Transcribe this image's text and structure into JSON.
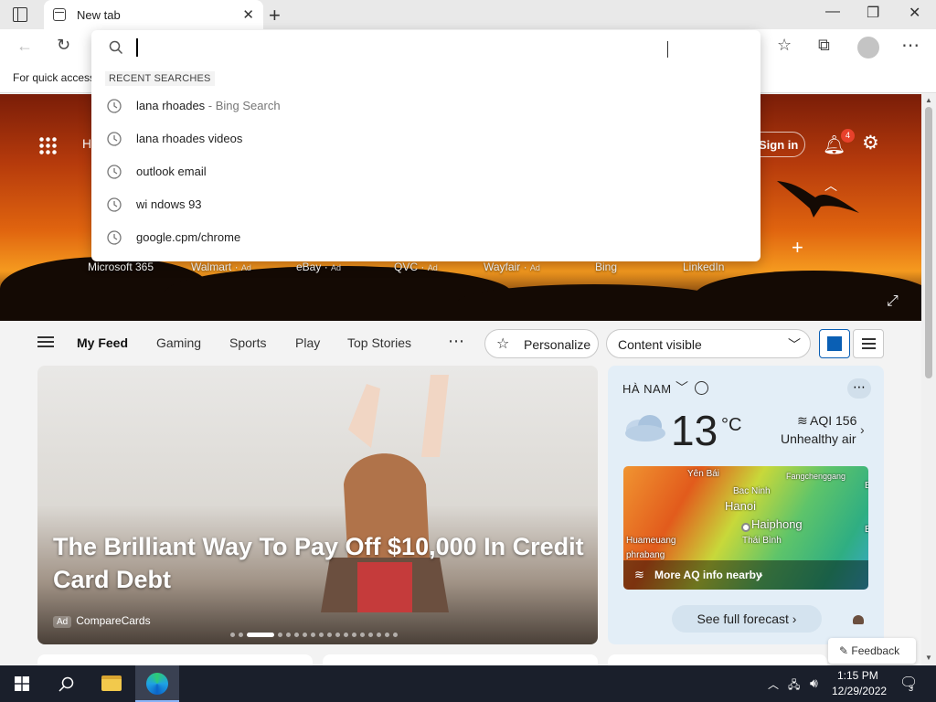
{
  "browser": {
    "tab_title": "New tab",
    "favorites_hint": "For quick access"
  },
  "dropdown": {
    "header": "RECENT SEARCHES",
    "items": [
      {
        "text": "lana rhoades",
        "sub": " - Bing Search"
      },
      {
        "text": "lana rhoades videos",
        "sub": ""
      },
      {
        "text": "outlook email",
        "sub": ""
      },
      {
        "text": "wi ndows 93",
        "sub": ""
      },
      {
        "text": "google.cpm/chrome",
        "sub": ""
      }
    ]
  },
  "hero": {
    "partial_label": "H",
    "signin": "Sign in",
    "notifications": "4",
    "links": [
      {
        "label": "Microsoft 365",
        "ad": ""
      },
      {
        "label": "Walmart",
        "ad": "Ad"
      },
      {
        "label": "eBay",
        "ad": "Ad"
      },
      {
        "label": "QVC",
        "ad": "Ad"
      },
      {
        "label": "Wayfair",
        "ad": "Ad"
      },
      {
        "label": "Bing",
        "ad": ""
      },
      {
        "label": "LinkedIn",
        "ad": ""
      }
    ]
  },
  "feed": {
    "tabs": [
      "My Feed",
      "Gaming",
      "Sports",
      "Play",
      "Top Stories"
    ],
    "personalize": "Personalize",
    "content_visible": "Content visible"
  },
  "main_card": {
    "headline": "The Brilliant Way To Pay Off $10,000 In Credit Card Debt",
    "ad_label": "Ad",
    "source": "CompareCards",
    "carousel_total": 18,
    "carousel_active": 2
  },
  "weather": {
    "location": "HÀ NAM",
    "temperature": "13",
    "unit": "°C",
    "aqi": "AQI 156",
    "aqi_status": "Unhealthy air",
    "map_labels": {
      "yen_bai": "Yên Bái",
      "bac_ninh": "Bac Ninh",
      "fangchenggang": "Fangchenggang",
      "hanoi": "Hanoi",
      "haiphong": "Haiphong",
      "huameuang": "Huameuang",
      "thai_binh": "Thái Bình",
      "phrabang": "phrabang",
      "edge_b1": "B",
      "edge_b2": "B"
    },
    "aq_link": "More AQ info nearby",
    "forecast": "See full forecast"
  },
  "feedback": "Feedback",
  "taskbar": {
    "time": "1:15 PM",
    "date": "12/29/2022",
    "notifications": "3"
  },
  "colors": {
    "accent": "#0a5fb4",
    "badge": "#e8412b",
    "taskbar": "#1a1f2b"
  }
}
